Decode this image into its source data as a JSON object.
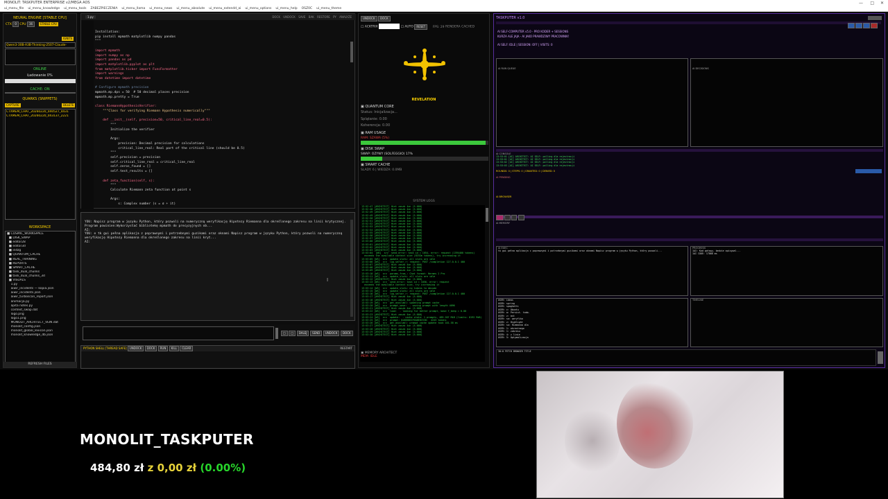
{
  "window": {
    "title": "MONOLIT: TASKPUTER ENTERPRISE v2/MEGA AOS",
    "menu": [
      "ui_menu_file",
      "ui_menu_knowledge",
      "ui_menu_tools",
      "ZABEZPIECZENIA",
      "ui_menu_llama",
      "ui_menu_news",
      "ui_menu_absolute",
      "ui_menu_extendd_ai",
      "ui_menu_options",
      "ui_menu_help",
      "OSZ0C",
      "ui_menu_theme"
    ]
  },
  "left_panel": {
    "engine": "NEURAL ENGINE [STABLE CPU]",
    "ctx_label": "CTX",
    "ctx_value": "0",
    "cpu_label": "CPU",
    "cpu_value": "36",
    "stable_tag": "STABLE CPU",
    "ignite": "IGNITE",
    "model": "Qwen3-30B-A3B-Thinking-2507-Claude-",
    "online": "ONLINE",
    "loading": "Ładowanie 0%",
    "cache": "CACHE: ON",
    "quarks_title": "QUARKS (SNIPPETS)",
    "capture": "CAPTURE",
    "delete": "DELETE",
    "quarks": [
      "CTXMEM_CHAT_20260220_040527_4431",
      "CTXMEM_CHAT_20260220_043137_2221"
    ],
    "workspace_title": "WORKSPACE",
    "workspace_root": "COSMIC_WORKSPACE",
    "tree": [
      "DISK_SWAP",
      "editor28",
      "editor3d",
      "indzg",
      "QUANTUM_CACHE",
      "REAL_TRAINING",
      "REPORTS",
      "SMART_CACHE",
      "task_dual_chunks",
      "task_dual_chunks_3d",
      "VISUALS",
      "1.py",
      "aiwir_incidents — kopia.json",
      "aiwir_incidents.json",
      "aiwir_turboscan_report.json",
      "animacja.py",
      "apita notes.py",
      "context_swap.dat",
      "logo.png",
      "logo1.png",
      "MONOLIT_ARCHITECT_VEIN.dat",
      "monolit_config.json",
      "monolit_global_lexicon.json",
      "monolit_knowledge_db.json"
    ],
    "refresh": "REFRESH FILES"
  },
  "editor": {
    "tab": "1.py",
    "toolbar": "DOCK  UNDOCK  SAVE  BAK  RESTORE  PY  ANALYZE",
    "code_lines": [
      [
        "",
        "Installation:"
      ],
      [
        "",
        "pip install mpmath matplotlib numpy pandas"
      ],
      [
        "",
        "\"\"\""
      ],
      [
        "",
        ""
      ],
      [
        "kw",
        "import mpmath"
      ],
      [
        "kw",
        "import numpy as np"
      ],
      [
        "kw",
        "import pandas as pd"
      ],
      [
        "kw",
        "import matplotlib.pyplot as plt"
      ],
      [
        "kw",
        "from matplotlib.ticker import FuncFormatter"
      ],
      [
        "kw",
        "import warnings"
      ],
      [
        "kw",
        "from datetime import datetime"
      ],
      [
        "",
        ""
      ],
      [
        "cm",
        "# Configure mpmath precision"
      ],
      [
        "",
        "mpmath.mp.dps = 50  # 50 decimal places precision"
      ],
      [
        "",
        "mpmath.mp.pretty = True"
      ],
      [
        "",
        ""
      ],
      [
        "kw",
        "class RiemannHypothesisVerifier:"
      ],
      [
        "st",
        "    \"\"\"Class for verifying Riemann Hypothesis numerically\"\"\""
      ],
      [
        "",
        ""
      ],
      [
        "kw",
        "    def __init__(self, precision=50, critical_line_real=0.5):"
      ],
      [
        "",
        "        \"\"\""
      ],
      [
        "",
        "        Initialize the verifier"
      ],
      [
        "",
        ""
      ],
      [
        "",
        "        Args:"
      ],
      [
        "",
        "            precision: Decimal precision for calculations"
      ],
      [
        "",
        "            critical_line_real: Real part of the critical line (should be 0.5)"
      ],
      [
        "",
        "        \"\"\""
      ],
      [
        "",
        "        self.precision = precision"
      ],
      [
        "",
        "        self.critical_line_real = critical_line_real"
      ],
      [
        "",
        "        self.zeros_found = []"
      ],
      [
        "",
        "        self.test_results = []"
      ],
      [
        "",
        ""
      ],
      [
        "kw",
        "    def zeta_function(self, s):"
      ],
      [
        "",
        "        \"\"\""
      ],
      [
        "",
        "        Calculate Riemann zeta function at point s"
      ],
      [
        "",
        ""
      ],
      [
        "",
        "        Args:"
      ],
      [
        "",
        "            s: Complex number (s = σ + it)"
      ]
    ]
  },
  "chat": {
    "text": "YOU: Napisz program w języku Python, który pozwoli na numeryczną weryfikację Hipotezy Riemanna dla określonego zakresu na linii krytycznej. Program powinien:Wykorzystać bibliotekę mpmath do precyzyjnych ob...\nAI:\nYOU: e tk gui pełna aplikacja z poprawnymi i potrzebnymi guzikami oraz oknami Napisz program w języku Python, który pozwoli na numeryczną weryfikację Hipotezy Riemanna dla określonego zakresu na linii kryt...\nAI:",
    "buttons": [
      "DALEJ",
      "SEND",
      "UNDOCK",
      "DOCK"
    ],
    "shell_title": "PYTHON SHELL [THREAD SAFE]",
    "shell_buttons": [
      "UNDOCK",
      "DOCK",
      "RUN",
      "KILL",
      "CLEAR"
    ],
    "restart": "RESTART"
  },
  "middle": {
    "tabs": [
      "UNDOCK",
      "DOCK"
    ],
    "acktrix": "ACKTRIX",
    "auto": "AUTO",
    "reset": "RESET",
    "fps": "FPS: 29",
    "render": "RENDERA",
    "cached": "CACHED",
    "revelation": "REVELATION",
    "quantum_title": "QUANTUM CORE",
    "status": "Status: Inicjalizacja...",
    "splatanie": "Splątanie: 0.00",
    "koherencja": "Koherencja: 0.00",
    "ram_title": "RAM USAGE",
    "ram_text": "RAM: SZAWA (5%)",
    "ram_fraction": 0.98,
    "disk_title": "DISK SWAP",
    "disk_text": "SWAP: OZYWY (SOLFEGGIO) 17%",
    "disk_fraction": 0.17,
    "smart_title": "SMART CACHE",
    "smart_text": "SLADY: 6 | WIEDZA: 0.0MB",
    "logs_title": "SYSTEM LOGS",
    "logs": [
      "13:52:47 [ARCHITECT] Hint zaszb 4xn (5.000)",
      "13:52:48 [ARCHITECT] Hint zaszb 4xn (5.000)",
      "13:52:49 [ARCHITECT] Hint zaszb 4xn (5.000)",
      "13:52:49 [ARCHITECT] Hint zaszb 4xn (5.000)",
      "13:52:50 [ARCHITECT] Hint zaszb 4xn (5.000)",
      "13:52:51 [ARCHITECT] Hint zaszb 4xn (5.000)",
      "13:52:52 [ARCHITECT] Hint zaszb 4xn (5.000)",
      "13:52:53 [ARCHITECT] Hint zaszb 4xn (5.000)",
      "13:52:54 [ARCHITECT] Hint zaszb 4xn (5.000)",
      "13:52:55 [ARCHITECT] Hint zaszb 4xn (5.000)",
      "13:52:56 [ARCHITECT] Hint zaszb 4xn (5.000)",
      "13:52:57 [ARCHITECT] Hint zaszb 4xn (5.000)",
      "13:53:00 [ARCHITECT] Hint zaszb 4xn (5.000)",
      "13:53:01 [ARCHITECT] Hint zaszb 4xn (5.000)",
      "13:53:02 [ARCHITECT] Hint zaszb 4xn (5.000)",
      "13:53:03 [ARCHITECT] Hint zaszb 4xn (5.000)",
      "13:53:04  [WS]  srv  send_error: task id = 1054, error: request (1594460 tokens)",
      "  exceeds the available context size (8192m tokens), try increasing it",
      "13:53:05 [WS]  srv  update_slots: all slots are idle",
      "13:53:06 [WS]  srv  log_server_r: request: POST /completion 127.0.0.1 400",
      "13:53:07 [ARCHITECT] Hint zaszb 4xn (5.000)",
      "13:53:08 [ARCHITECT] Hint zaszb 4xn (5.000)",
      "13:53:09 [ARCHITECT] Hint zaszb 4xn (5.000)",
      "13:53:10 [WS]  srv  params_from_: Chat format: Hermes 2 Pro",
      "13:53:11 [WS]  srv  update_slots: all slots are idle",
      "13:53:12 [ARCHITECT] Hint zaszb 4xn (5.000)",
      "13:53:13 [WS]  srv  send_error: task id = 1056, error: request",
      "  exceeds the available context size, try increasing it",
      "13:53:14 [WS]  srv  update_slots: no tokens to decode",
      "13:53:15 [WS]  srv  update_slots: all slots are idle",
      "13:53:16 [WS]  srv  log_server_r: request: POST /completion 127.0.0.1 400",
      "13:53:17 [ARCHITECT] Hint zaszb 4xn (5.000)",
      "13:53:18 [ARCHITECT] Hint zaszb 4xn (5.000)",
      "13:53:19 [WS]  srv  get_availabl: updating prompt cache",
      "13:53:20 [WS]  srv  prompt_save:  - saving prompt with length 4096",
      "13:53:21 [ARCHITECT] Hint zaszb 4xn (5.000)",
      "13:53:22 [WS]  srv  load:  - looking for better prompt, base f_keep = 0.00",
      "13:53:23 [ARCHITECT] Hint zaszb 4xn (5.000)",
      "13:53:24 [WS]  srv  update:  - cache state: 1 prompts, 485.207 MiB (limits: 8192 MiB)",
      "13:53:25 [WS]  srv  prompt: 0x000001F6A8E8C530:  4243 tokens",
      "13:53:26 [WS]  srv  get_availabl: prompt cache update took 101.58 ms",
      "13:53:27 [ARCHITECT] Hint zaszb 4xn (5.000)",
      "13:53:28 [ARCHITECT] Hint zaszb 4xn (5.000)",
      "13:53:29 [ARCHITECT] Hint zaszb 4xn (5.000)",
      "13:53:30 [ARCHITECT] Hint zaszb 4xn (5.000)"
    ],
    "memory_title": "MEMORY ARCHITECT",
    "memory_status": "MEM: IDLE"
  },
  "right_panel": {
    "title": "TASKPUTER v1.0",
    "header1": "AI SELF-COMPUTER v5.0 - PRO KODER + SESSIONS",
    "header2": "KURZA ALE JAJA - AI JAKO PRAWDZIWY PRACOWNIK!",
    "status_line": "AI SELF: IDLE | SESSION: OFF | VISITS: 0",
    "col_left": "AI RUN QUEUE",
    "col_right": "AI DECISIONS",
    "console_title": "AI CONSOLE",
    "console_lines": [
      "13:53:01 [AI] ARCHITECT: AI SELF: polling dla rejestracji",
      "13:53:01 [AI] ARCHITECT: AI SELF: polling dla rejestracji",
      "13:53:02 [AI] ARCHITECT: AI SELF: polling dla rejestracji",
      "13:53:03 [AI] ARCHITECT: AI SELF: polling dla rejestracji"
    ],
    "rounds": "ROUNDS: 0 | STEPS: 0 | GRANTED: 0 | DENIED: 0",
    "pending": "AI PENDING",
    "browser": "AI BROWSER",
    "memory": "AI MEMORY",
    "exec": "AI EXEC",
    "progress": "PROGRESS",
    "timeline": "TIMELINE",
    "chat_line": "tk gui pełna aplikacja z poprawnymi i potrzebnymi guzikami oraz oknami Napisz program w języku Python, który pozwoli...",
    "ai_lines": [
      "1AI: Kod gotowy, bedzie opisywal...",
      "1AI CODE: 17888 ms"
    ],
    "list_lines": [
      "USER: ideas",
      "USER: spring",
      "USER: spaghetti",
      "USER: c: Ubuntu",
      "USER: a: Persist. todo.",
      "USER: z: ast",
      "USER: so: weryfiko",
      "USER: z: Highlight",
      "USER: so: Riemanna dla",
      "USER: 1: okrestnego",
      "USER: 1: zakresu",
      "USER: 4: z linie",
      "USER: 5: Optymalizacja"
    ],
    "ops_lines": [
      "30:0 FETCH BROWSER TITLE"
    ]
  },
  "stream": {
    "brand": "MONOLIT_TASKPUTER",
    "price": "484,80 zł",
    "change": "z 0,00 zł",
    "pct": "(0.00%)"
  }
}
